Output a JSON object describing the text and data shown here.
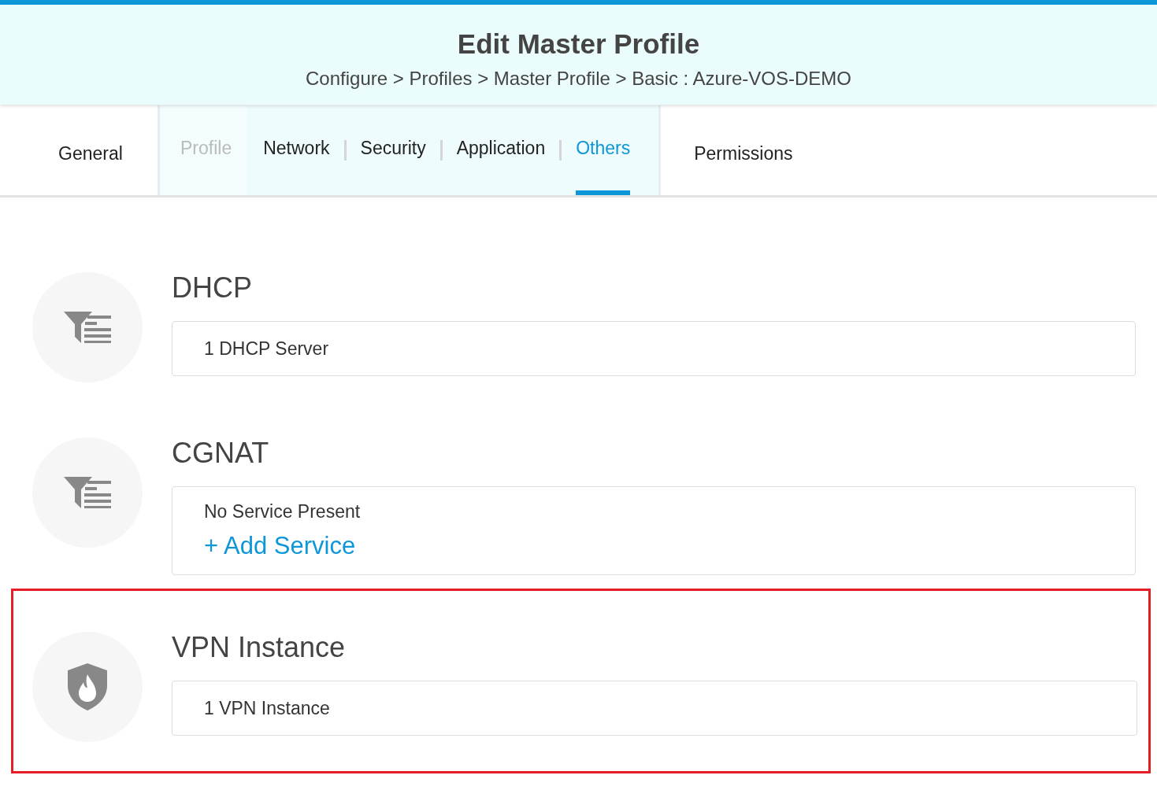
{
  "header": {
    "title": "Edit Master Profile",
    "breadcrumb": "Configure > Profiles > Master Profile > Basic : Azure-VOS-DEMO"
  },
  "tabs": [
    {
      "label": "General",
      "selected": false
    },
    {
      "kind": "group",
      "children": [
        {
          "label": "Profile",
          "selected": false,
          "disabled": true
        },
        {
          "label": "Network",
          "selected": false,
          "disabled": false
        },
        {
          "label": "Security",
          "selected": false,
          "disabled": false
        },
        {
          "label": "Application",
          "selected": false,
          "disabled": false
        },
        {
          "label": "Others",
          "selected": true,
          "disabled": false
        }
      ]
    },
    {
      "label": "Permissions",
      "selected": false
    }
  ],
  "sections": [
    {
      "title": "DHCP",
      "kind": "filter",
      "highlighted": false,
      "lines": [
        {
          "kind": "text",
          "text": "1 DHCP Server"
        }
      ]
    },
    {
      "title": "CGNAT",
      "kind": "filter",
      "highlighted": false,
      "lines": [
        {
          "kind": "text",
          "text": "No Service Present"
        },
        {
          "kind": "link",
          "text": "+ Add Service"
        }
      ]
    },
    {
      "title": "VPN Instance",
      "kind": "shield",
      "highlighted": true,
      "lines": [
        {
          "kind": "text",
          "text": "1 VPN Instance"
        }
      ]
    }
  ]
}
